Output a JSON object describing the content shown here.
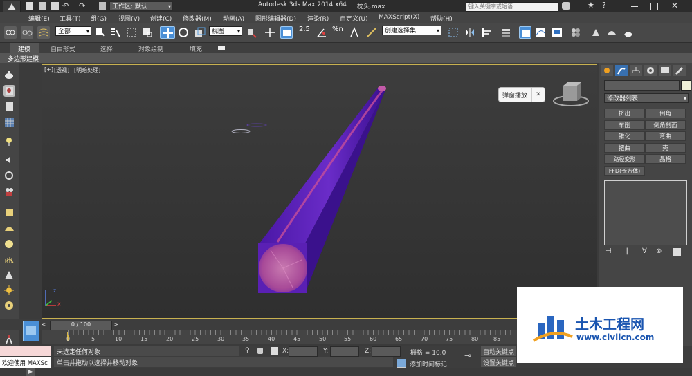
{
  "titlebar": {
    "workspace_label": "工作区: 默认",
    "app_title": "Autodesk 3ds Max  2014 x64",
    "file_name": "枕头.max",
    "search_placeholder": "键入关键字或短语"
  },
  "menu": [
    "编辑(E)",
    "工具(T)",
    "组(G)",
    "视图(V)",
    "创建(C)",
    "修改器(M)",
    "动画(A)",
    "图形编辑器(D)",
    "渲染(R)",
    "自定义(U)",
    "MAXScript(X)",
    "帮助(H)"
  ],
  "toolbar": {
    "selection_filter": "全部",
    "ref_coord": "视图",
    "angle_snap": "2.5",
    "percent_snap": "%n",
    "named_selection": "创建选择集"
  },
  "ribbon": {
    "tabs": [
      "建模",
      "自由形式",
      "选择",
      "对象绘制",
      "填充"
    ],
    "sub_label": "多边形建模"
  },
  "viewport": {
    "label_plus": "[+]",
    "label_view": "[透视]",
    "label_shading": "[明暗处理]",
    "popup_label": "弹窗播放",
    "popup_close": "✕",
    "axis_z": "z",
    "axis_x": "x",
    "colors": {
      "object": "#5a1fb4",
      "highlight": "#c8508c",
      "border": "#c8b150"
    }
  },
  "command_panel": {
    "name_field": "",
    "modifier_list": "修改器列表",
    "buttons": [
      "挤出",
      "倒角",
      "车削",
      "倒角剖面",
      "锥化",
      "弯曲",
      "扭曲",
      "壳",
      "路径变形 (WSM)",
      "晶格",
      "FFD(长方体)"
    ]
  },
  "timeline": {
    "frame_display": "0 / 100",
    "ticks": [
      "0",
      "5",
      "10",
      "15",
      "20",
      "25",
      "30",
      "35",
      "40",
      "45",
      "50",
      "55",
      "60",
      "65",
      "70",
      "75",
      "80",
      "85"
    ]
  },
  "status": {
    "welcome": "欢迎使用 MAXSc",
    "selection_status": "未选定任何对象",
    "prompt": "单击并拖动以选择并移动对象",
    "x_label": "X:",
    "y_label": "Y:",
    "z_label": "Z:",
    "grid": "栅格 = 10.0",
    "auto_key": "自动关键点",
    "set_key": "设置关键点",
    "add_time_tag": "添加时间标记"
  },
  "watermark": {
    "cn": "土木工程网",
    "url": "www.civilcn.com"
  }
}
